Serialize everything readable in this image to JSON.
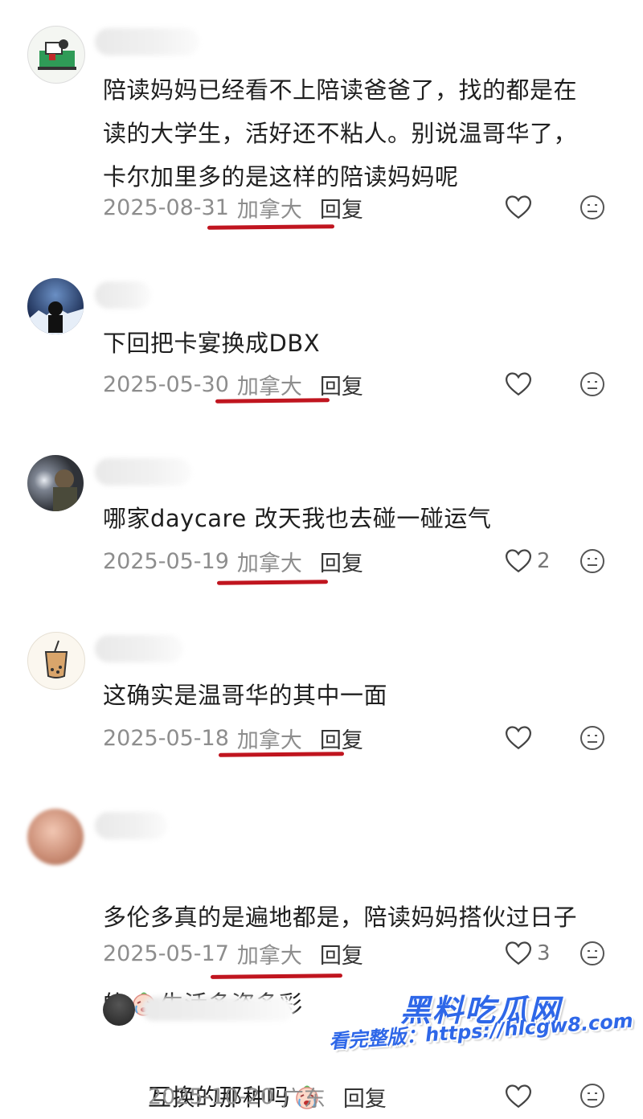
{
  "comments": [
    {
      "text": "陪读妈妈已经看不上陪读爸爸了，找的都是在\n读的大学生，活好还不粘人。别说温哥华了，\n卡尔加里多的是这样的陪读妈妈呢",
      "date": "2025-08-31",
      "location": "加拿大",
      "reply_label": "回复",
      "likes": ""
    },
    {
      "text": "下回把卡宴换成DBX",
      "date": "2025-05-30",
      "location": "加拿大",
      "reply_label": "回复",
      "likes": ""
    },
    {
      "text": "哪家daycare 改天我也去碰一碰运气",
      "date": "2025-05-19",
      "location": "加拿大",
      "reply_label": "回复",
      "likes": "2"
    },
    {
      "text": "这确实是温哥华的其中一面",
      "date": "2025-05-18",
      "location": "加拿大",
      "reply_label": "回复",
      "likes": ""
    },
    {
      "text_line1": "多伦多真的是遍地都是，陪读妈妈搭伙过日子",
      "text_line2_pre": "的",
      "text_line2_post": "生活多姿多彩",
      "date": "2025-05-17",
      "location": "加拿大",
      "reply_label": "回复",
      "likes": "3"
    },
    {
      "text_pre": "互换的那种吗",
      "date": "2025-10-20",
      "location": "广东",
      "reply_label": "回复"
    }
  ],
  "watermark": {
    "title": "黑料吃瓜网",
    "subtitle": "看完整版：https://hlcgw8.com"
  },
  "colors": {
    "underline": "#c0151f",
    "watermark": "#2e67e8",
    "meta_text": "#8d8d8d"
  },
  "icons": [
    "heart-outline-icon",
    "emoji-face-icon",
    "crying-emoji-icon"
  ]
}
